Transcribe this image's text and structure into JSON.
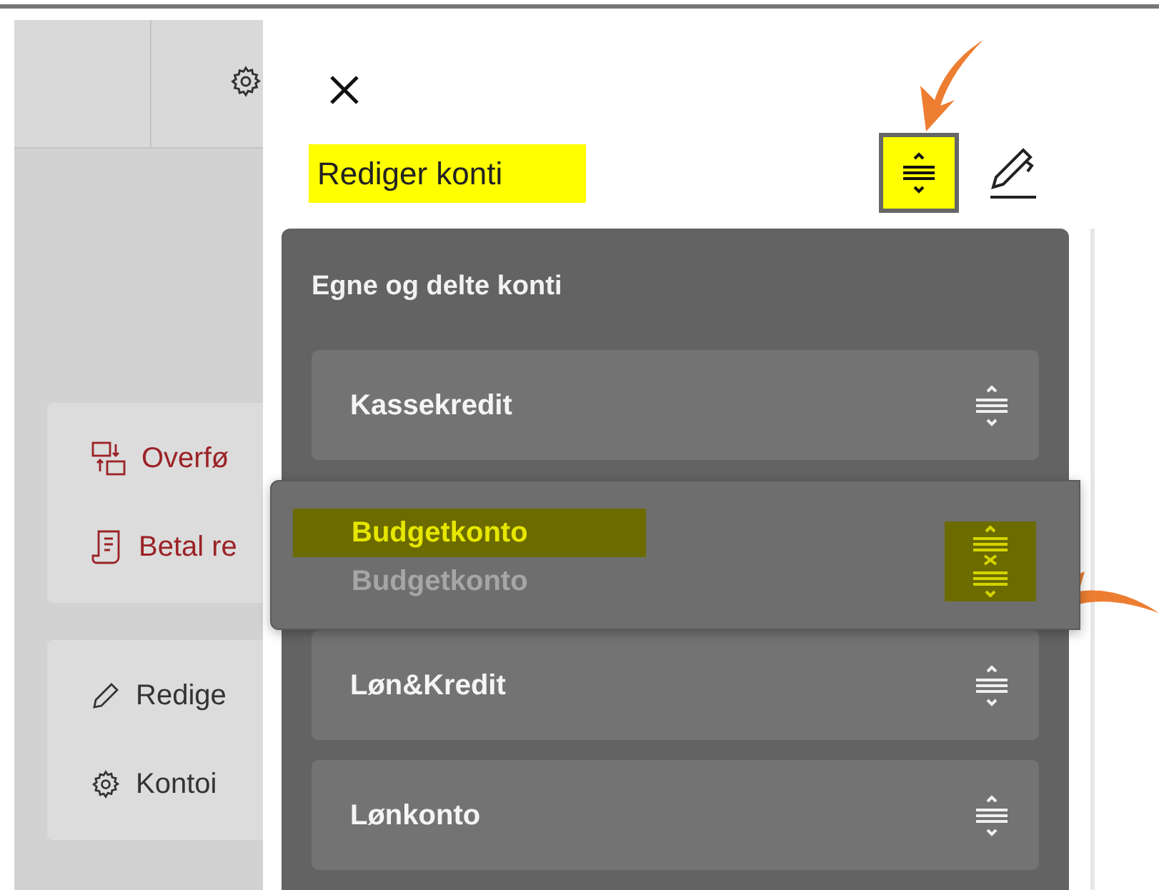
{
  "background": {
    "menu_groups": [
      {
        "items": [
          {
            "label": "Overfø",
            "kind": "transfer"
          },
          {
            "label": "Betal re",
            "kind": "bill"
          }
        ]
      },
      {
        "items": [
          {
            "label": "Redige",
            "kind": "edit"
          },
          {
            "label": "Kontoi",
            "kind": "settings"
          }
        ]
      }
    ]
  },
  "panel": {
    "title": "Rediger konti",
    "title_highlighted": true,
    "reorder_button": {
      "selected": true
    },
    "section": {
      "title": "Egne og delte konti",
      "accounts": [
        {
          "label": "Kassekredit",
          "dragging": false
        },
        {
          "label": "Budgetkonto",
          "dragging": true,
          "ghost_label": "Budgetkonto"
        },
        {
          "label": "Løn&Kredit",
          "dragging": false
        },
        {
          "label": "Lønkonto",
          "dragging": false
        }
      ]
    }
  }
}
